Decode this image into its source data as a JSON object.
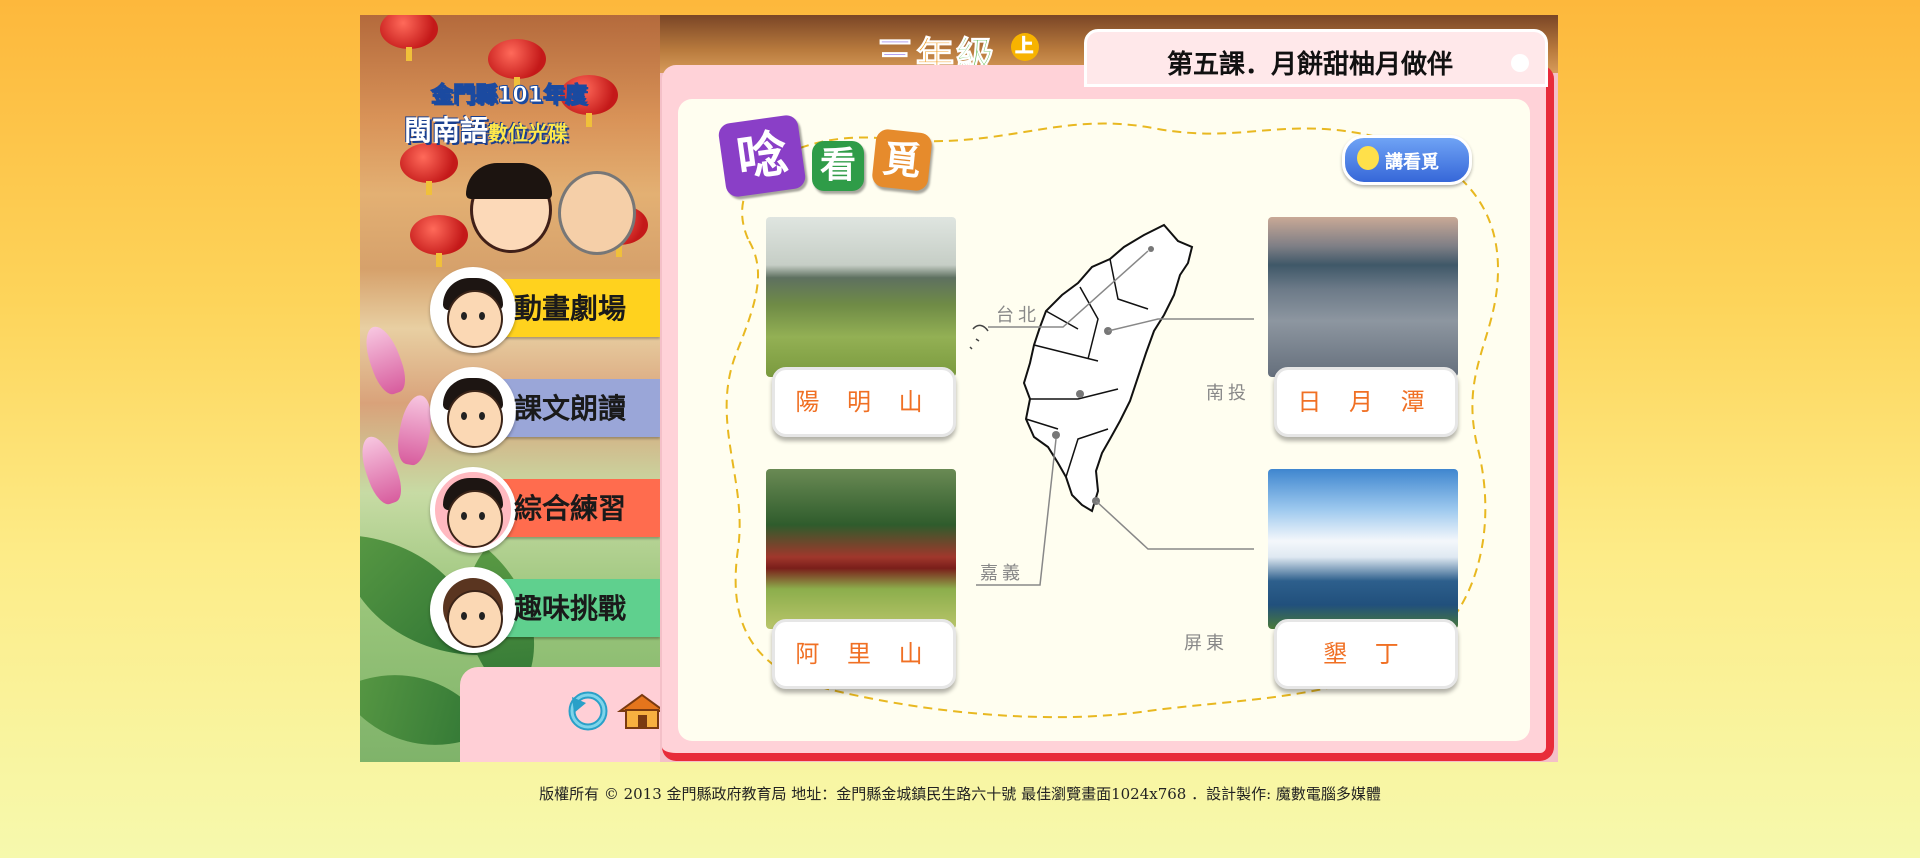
{
  "app": {
    "logo_line1": "金門縣101年度",
    "logo_line2": "閩南語",
    "logo_line2_small": "數位光碟",
    "grade_chars": [
      "三",
      "年",
      "級"
    ],
    "grade_badge": "上"
  },
  "lesson": {
    "title": "第五課．月餅甜柚月做伴"
  },
  "menu": {
    "items": [
      {
        "label": "動畫劇場",
        "color": "#ffd21e"
      },
      {
        "label": "課文朗讀",
        "color": "#9aa6d8"
      },
      {
        "label": "綜合練習",
        "color": "#ff6c4e"
      },
      {
        "label": "趣味挑戰",
        "color": "#5fd08e"
      }
    ]
  },
  "tools": {
    "back_icon": "back-arrow-icon",
    "home_icon": "home-icon"
  },
  "content": {
    "heading": [
      "唸",
      "看",
      "覓"
    ],
    "speak_button": "講看覓",
    "places": [
      {
        "name": "陽 明 山"
      },
      {
        "name": "日 月 潭"
      },
      {
        "name": "阿 里 山"
      },
      {
        "name": "墾 丁"
      }
    ],
    "map_labels": {
      "taipei": "台北",
      "nantou": "南投",
      "chiayi": "嘉義",
      "pingtung": "屏東"
    }
  },
  "footer": {
    "text": "版權所有 © 2013  金門縣政府教育局  地址：金門縣金城鎮民生路六十號  最佳瀏覽畫面1024x768  ．設計製作: 魔數電腦多媒體"
  },
  "colors": {
    "accent_red": "#e82c3a",
    "place_text": "#f07024"
  }
}
